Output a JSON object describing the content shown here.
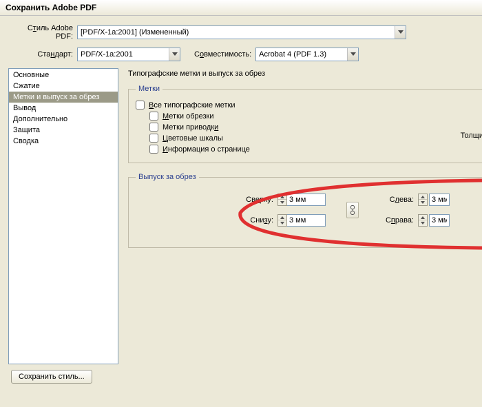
{
  "window": {
    "title": "Сохранить Adobe PDF"
  },
  "preset": {
    "label_prefix": "С",
    "label_u": "т",
    "label_suffix": "иль Adobe PDF:",
    "value": "[PDF/X-1a:2001] (Измененный)"
  },
  "standard": {
    "label_prefix": "Ста",
    "label_u": "н",
    "label_suffix": "дарт:",
    "value": "PDF/X-1a:2001"
  },
  "compat": {
    "label_prefix": "С",
    "label_u": "о",
    "label_suffix": "вместимость:",
    "value": "Acrobat 4 (PDF 1.3)"
  },
  "sidebar": {
    "items": [
      {
        "label": "Основные"
      },
      {
        "label": "Сжатие"
      },
      {
        "label": "Метки и выпуск за обрез"
      },
      {
        "label": "Вывод"
      },
      {
        "label": "Дополнительно"
      },
      {
        "label": "Защита"
      },
      {
        "label": "Сводка"
      }
    ],
    "selected_index": 2
  },
  "panel": {
    "title": "Типографские метки и выпуск за обрез",
    "marks": {
      "legend": "Метки",
      "all_prefix": "",
      "all_u": "В",
      "all_suffix": "се типографские метки",
      "trim_prefix": "",
      "trim_u": "М",
      "trim_suffix": "етки обрезки",
      "reg_prefix": "Метки приводк",
      "reg_u": "и",
      "reg_suffix": "",
      "color_u": "Ц",
      "color_suffix": "ветовые шкалы",
      "page_u": "И",
      "page_suffix": "нформация о странице",
      "weight_label": "Толщи"
    },
    "bleed": {
      "legend": "Выпуск за обрез",
      "top_prefix": "Св",
      "top_u": "е",
      "top_suffix": "рху:",
      "bottom_prefix": "Сни",
      "bottom_u": "з",
      "bottom_suffix": "у:",
      "left_prefix": "С",
      "left_u": "л",
      "left_suffix": "ева:",
      "right_prefix": "С",
      "right_u": "п",
      "right_suffix": "рава:",
      "top_value": "3 мм",
      "bottom_value": "3 мм",
      "left_value": "3 мм",
      "right_value": "3 мм"
    }
  },
  "buttons": {
    "save_style": "Сохранить стиль..."
  }
}
